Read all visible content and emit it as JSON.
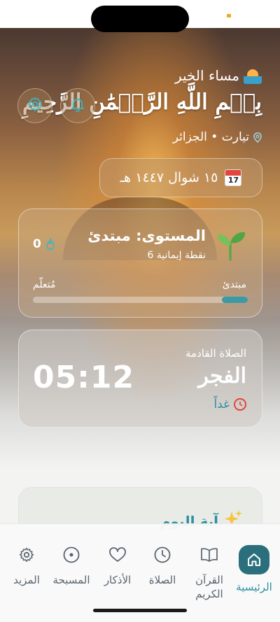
{
  "greeting": "مساء الخير",
  "basmala": "بِسۡمِ اللَّهِ الرَّحۡمَٰنِ الرَّحِيمِ",
  "location": "تيارت • الجزائر",
  "date": {
    "text": "١٥ شوال ١٤٤٧ هـ",
    "calendar_month": "July",
    "calendar_day": "17"
  },
  "level": {
    "title": "المستوى: مبتدئ",
    "points": "6 نقطة إيمانية",
    "streak": "0",
    "start_label": "مبتدئ",
    "end_label": "مُتعلّم",
    "progress": 0.12
  },
  "next_prayer": {
    "label": "الصلاة القادمة",
    "name": "الفجر",
    "when": "غداً",
    "time": "05:12"
  },
  "ayah": {
    "title": "آية اليوم"
  },
  "nav": {
    "home": "الرئيسية",
    "quran_line1": "القرآن",
    "quran_line2": "الكريم",
    "prayer": "الصلاة",
    "adhkar": "الأذكار",
    "tasbih": "المسبحة",
    "more": "المزيد"
  },
  "colors": {
    "accent": "#2d8fa0",
    "accent_dark": "#2b6f7d",
    "alarm": "#e2453b"
  }
}
